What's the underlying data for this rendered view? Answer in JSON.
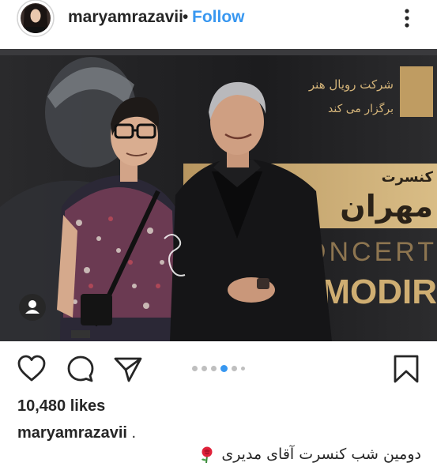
{
  "header": {
    "username": "maryamrazavii",
    "separator": "•",
    "follow_label": "Follow",
    "more_icon": "more-vertical-icon"
  },
  "photo": {
    "backdrop_text_fa_1": "شرکت رویال هنر",
    "backdrop_text_fa_2": "برگزار می کند",
    "backdrop_text_fa_3": "کنسرت",
    "backdrop_text_fa_4": "مهران",
    "backdrop_text_en_1": "CONCERT",
    "backdrop_text_en_2": "N MODIR",
    "user_tag_icon": "person-icon"
  },
  "carousel": {
    "count": 6,
    "active_index": 3
  },
  "engagement": {
    "likes": "10,480 likes"
  },
  "caption": {
    "username": "maryamrazavii",
    "dot": ".",
    "text": "دومین شب کنسرت آقای مدیری"
  },
  "colors": {
    "accent": "#3897f0",
    "text": "#262626",
    "gold": "#c9a86a"
  }
}
